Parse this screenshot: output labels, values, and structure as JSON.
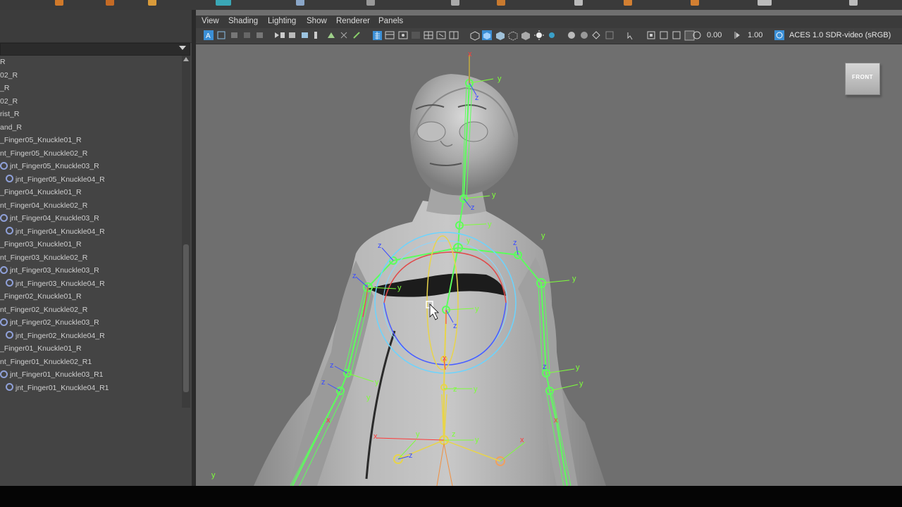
{
  "viewport": {
    "menu": [
      "View",
      "Shading",
      "Lighting",
      "Show",
      "Renderer",
      "Panels"
    ],
    "exposure_value": "0.00",
    "gamma_value": "1.00",
    "color_space": "ACES 1.0 SDR-video (sRGB)",
    "view_cube_label": "FRONT"
  },
  "outliner": {
    "items": [
      "R",
      "02_R",
      "_R",
      "02_R",
      "rist_R",
      "and_R",
      "_Finger05_Knuckle01_R",
      "nt_Finger05_Knuckle02_R",
      "jnt_Finger05_Knuckle03_R",
      "jnt_Finger05_Knuckle04_R",
      "_Finger04_Knuckle01_R",
      "nt_Finger04_Knuckle02_R",
      "jnt_Finger04_Knuckle03_R",
      "jnt_Finger04_Knuckle04_R",
      "_Finger03_Knuckle01_R",
      "nt_Finger03_Knuckle02_R",
      "jnt_Finger03_Knuckle03_R",
      "jnt_Finger03_Knuckle04_R",
      "_Finger02_Knuckle01_R",
      "nt_Finger02_Knuckle02_R",
      "jnt_Finger02_Knuckle03_R",
      "jnt_Finger02_Knuckle04_R",
      "_Finger01_Knuckle01_R",
      "nt_Finger01_Knuckle02_R1",
      "jnt_Finger01_Knuckle03_R1",
      "jnt_Finger01_Knuckle04_R1"
    ]
  },
  "colors": {
    "joint_green": "#5cff5c",
    "axis_x": "#ff3a3a",
    "axis_y": "#7dff3a",
    "axis_z": "#3a4dff",
    "spine_yellow": "#e8d44a",
    "viewport_bg": "#6f6f6f",
    "panel_bg": "#444444",
    "highlight_blue": "#3b8fd6"
  },
  "icons": [
    "joint-icon",
    "filter-chevron-icon",
    "scroll-up-icon",
    "view-cube-icon",
    "mouse-cursor-icon",
    "color-space-icon",
    "exposure-icon",
    "gamma-icon"
  ]
}
